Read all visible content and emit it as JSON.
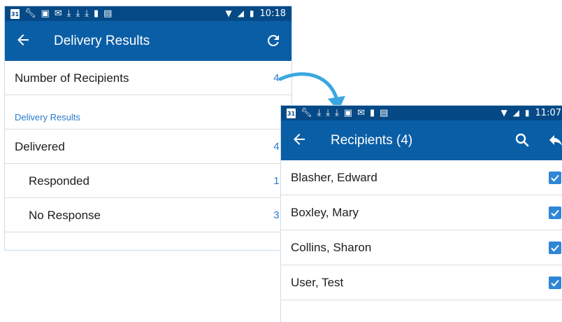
{
  "colors": {
    "statusbar": "#054a86",
    "appbar": "#0a5ea6",
    "accent": "#2a7bc8",
    "checkbox": "#2f86d6"
  },
  "screen1": {
    "statusbar": {
      "icons": [
        "calendar-icon",
        "wrench-icon",
        "image-icon",
        "gmail-icon",
        "download-icon",
        "download-icon",
        "download-icon",
        "folder-icon",
        "download-box-icon"
      ],
      "calendar_day": "31",
      "time": "10:18"
    },
    "appbar": {
      "title": "Delivery Results"
    },
    "number_of_recipients": {
      "label": "Number of Recipients",
      "value": "4"
    },
    "section_title": "Delivery Results",
    "delivered": {
      "label": "Delivered",
      "value": "4"
    },
    "responded": {
      "label": "Responded",
      "value": "1"
    },
    "no_response": {
      "label": "No Response",
      "value": "3"
    }
  },
  "screen2": {
    "statusbar": {
      "calendar_day": "31",
      "time": "11:07"
    },
    "appbar": {
      "title": "Recipients (4)"
    },
    "recipients": [
      {
        "name": "Blasher, Edward",
        "checked": true
      },
      {
        "name": "Boxley, Mary",
        "checked": true
      },
      {
        "name": "Collins, Sharon",
        "checked": true
      },
      {
        "name": "User, Test",
        "checked": true
      }
    ]
  }
}
